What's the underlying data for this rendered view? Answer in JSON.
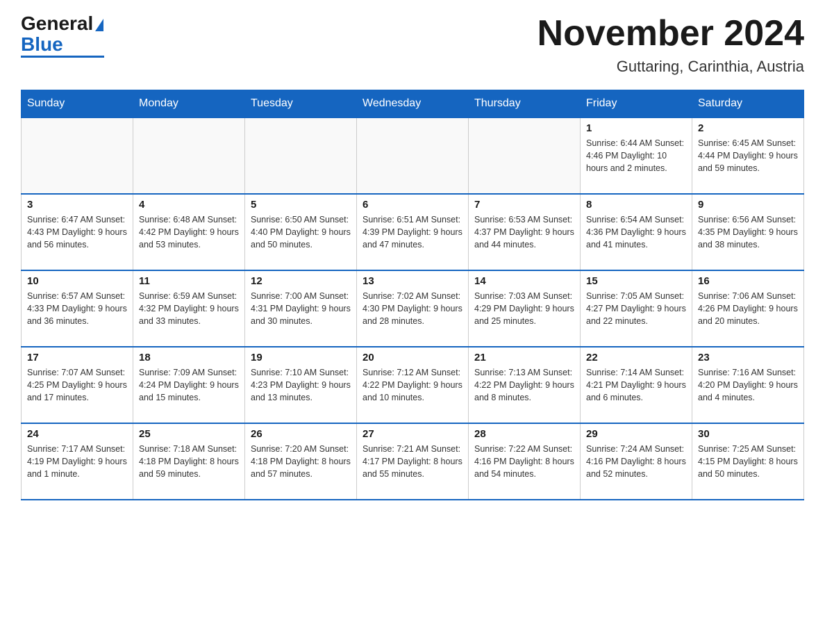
{
  "logo": {
    "general": "General",
    "blue": "Blue"
  },
  "title": "November 2024",
  "location": "Guttaring, Carinthia, Austria",
  "days_of_week": [
    "Sunday",
    "Monday",
    "Tuesday",
    "Wednesday",
    "Thursday",
    "Friday",
    "Saturday"
  ],
  "weeks": [
    [
      {
        "day": "",
        "info": ""
      },
      {
        "day": "",
        "info": ""
      },
      {
        "day": "",
        "info": ""
      },
      {
        "day": "",
        "info": ""
      },
      {
        "day": "",
        "info": ""
      },
      {
        "day": "1",
        "info": "Sunrise: 6:44 AM\nSunset: 4:46 PM\nDaylight: 10 hours and 2 minutes."
      },
      {
        "day": "2",
        "info": "Sunrise: 6:45 AM\nSunset: 4:44 PM\nDaylight: 9 hours and 59 minutes."
      }
    ],
    [
      {
        "day": "3",
        "info": "Sunrise: 6:47 AM\nSunset: 4:43 PM\nDaylight: 9 hours and 56 minutes."
      },
      {
        "day": "4",
        "info": "Sunrise: 6:48 AM\nSunset: 4:42 PM\nDaylight: 9 hours and 53 minutes."
      },
      {
        "day": "5",
        "info": "Sunrise: 6:50 AM\nSunset: 4:40 PM\nDaylight: 9 hours and 50 minutes."
      },
      {
        "day": "6",
        "info": "Sunrise: 6:51 AM\nSunset: 4:39 PM\nDaylight: 9 hours and 47 minutes."
      },
      {
        "day": "7",
        "info": "Sunrise: 6:53 AM\nSunset: 4:37 PM\nDaylight: 9 hours and 44 minutes."
      },
      {
        "day": "8",
        "info": "Sunrise: 6:54 AM\nSunset: 4:36 PM\nDaylight: 9 hours and 41 minutes."
      },
      {
        "day": "9",
        "info": "Sunrise: 6:56 AM\nSunset: 4:35 PM\nDaylight: 9 hours and 38 minutes."
      }
    ],
    [
      {
        "day": "10",
        "info": "Sunrise: 6:57 AM\nSunset: 4:33 PM\nDaylight: 9 hours and 36 minutes."
      },
      {
        "day": "11",
        "info": "Sunrise: 6:59 AM\nSunset: 4:32 PM\nDaylight: 9 hours and 33 minutes."
      },
      {
        "day": "12",
        "info": "Sunrise: 7:00 AM\nSunset: 4:31 PM\nDaylight: 9 hours and 30 minutes."
      },
      {
        "day": "13",
        "info": "Sunrise: 7:02 AM\nSunset: 4:30 PM\nDaylight: 9 hours and 28 minutes."
      },
      {
        "day": "14",
        "info": "Sunrise: 7:03 AM\nSunset: 4:29 PM\nDaylight: 9 hours and 25 minutes."
      },
      {
        "day": "15",
        "info": "Sunrise: 7:05 AM\nSunset: 4:27 PM\nDaylight: 9 hours and 22 minutes."
      },
      {
        "day": "16",
        "info": "Sunrise: 7:06 AM\nSunset: 4:26 PM\nDaylight: 9 hours and 20 minutes."
      }
    ],
    [
      {
        "day": "17",
        "info": "Sunrise: 7:07 AM\nSunset: 4:25 PM\nDaylight: 9 hours and 17 minutes."
      },
      {
        "day": "18",
        "info": "Sunrise: 7:09 AM\nSunset: 4:24 PM\nDaylight: 9 hours and 15 minutes."
      },
      {
        "day": "19",
        "info": "Sunrise: 7:10 AM\nSunset: 4:23 PM\nDaylight: 9 hours and 13 minutes."
      },
      {
        "day": "20",
        "info": "Sunrise: 7:12 AM\nSunset: 4:22 PM\nDaylight: 9 hours and 10 minutes."
      },
      {
        "day": "21",
        "info": "Sunrise: 7:13 AM\nSunset: 4:22 PM\nDaylight: 9 hours and 8 minutes."
      },
      {
        "day": "22",
        "info": "Sunrise: 7:14 AM\nSunset: 4:21 PM\nDaylight: 9 hours and 6 minutes."
      },
      {
        "day": "23",
        "info": "Sunrise: 7:16 AM\nSunset: 4:20 PM\nDaylight: 9 hours and 4 minutes."
      }
    ],
    [
      {
        "day": "24",
        "info": "Sunrise: 7:17 AM\nSunset: 4:19 PM\nDaylight: 9 hours and 1 minute."
      },
      {
        "day": "25",
        "info": "Sunrise: 7:18 AM\nSunset: 4:18 PM\nDaylight: 8 hours and 59 minutes."
      },
      {
        "day": "26",
        "info": "Sunrise: 7:20 AM\nSunset: 4:18 PM\nDaylight: 8 hours and 57 minutes."
      },
      {
        "day": "27",
        "info": "Sunrise: 7:21 AM\nSunset: 4:17 PM\nDaylight: 8 hours and 55 minutes."
      },
      {
        "day": "28",
        "info": "Sunrise: 7:22 AM\nSunset: 4:16 PM\nDaylight: 8 hours and 54 minutes."
      },
      {
        "day": "29",
        "info": "Sunrise: 7:24 AM\nSunset: 4:16 PM\nDaylight: 8 hours and 52 minutes."
      },
      {
        "day": "30",
        "info": "Sunrise: 7:25 AM\nSunset: 4:15 PM\nDaylight: 8 hours and 50 minutes."
      }
    ]
  ]
}
